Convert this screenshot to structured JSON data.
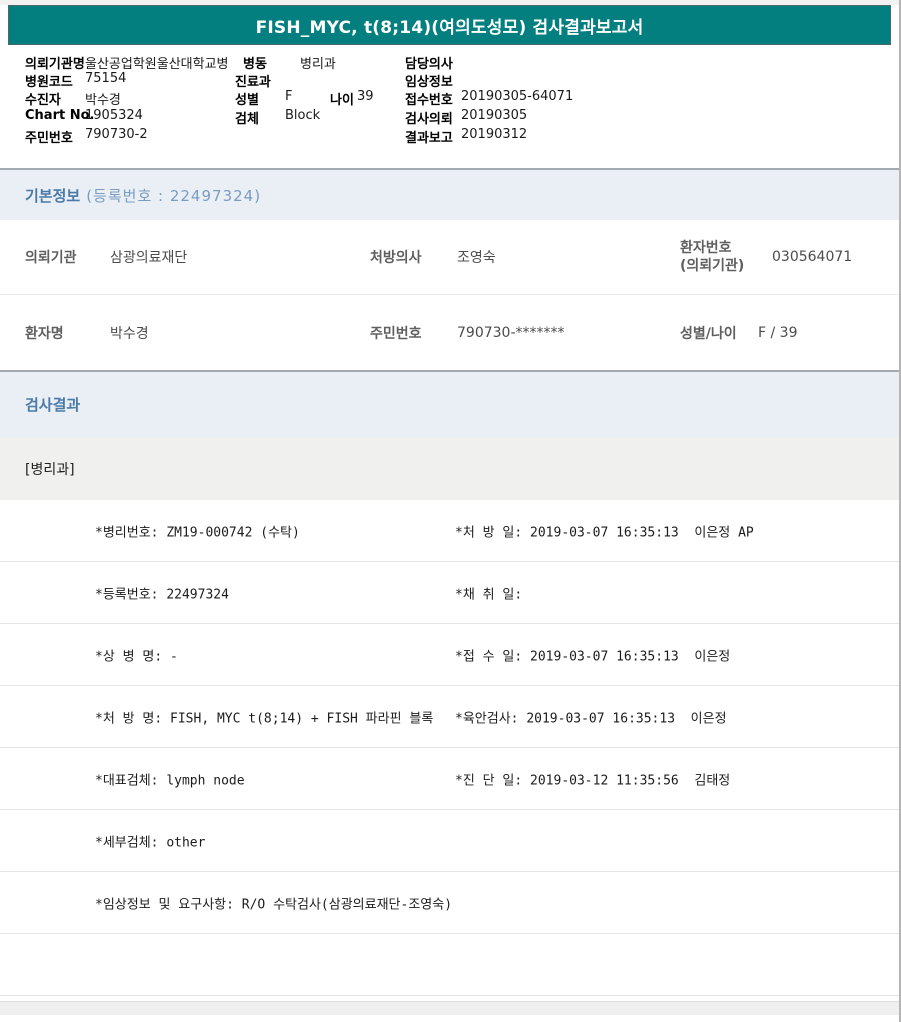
{
  "title_bar": {
    "text": "FISH_MYC, t(8;14)(여의도성모) 검사결과보고서",
    "bg_color": "#047f7f",
    "text_color": "#ffffff"
  },
  "patient_header": {
    "row1": {
      "l1": "의뢰기관명",
      "v1": "울산공업학원울산대학교병",
      "l2": "병동",
      "v2": "병리과",
      "l3": "담당의사",
      "v3": ""
    },
    "row2": {
      "l1": "병원코드",
      "v1": "75154",
      "l2": "진료과",
      "v2": "",
      "l3": "임상정보",
      "v3": ""
    },
    "row3": {
      "l1": "수진자",
      "v1": "박수경",
      "l2": "성별",
      "v2": "F",
      "l2b": "나이",
      "v2b": "39",
      "l3": "접수번호",
      "v3": "20190305-64071"
    },
    "row4": {
      "l1": "Chart No.",
      "v1": "1905324",
      "l2": "검체",
      "v2": "Block",
      "l3": "검사의뢰",
      "v3": "20190305"
    },
    "row5": {
      "l1": "주민번호",
      "v1": "790730-2",
      "l3": "결과보고",
      "v3": "20190312"
    }
  },
  "basic_info": {
    "section_title": "기본정보",
    "section_subtitle": "(등록번호 : 22497324)",
    "referral_org_label": "의뢰기관",
    "referral_org_value": "삼광의료재단",
    "prescribing_doctor_label": "처방의사",
    "prescribing_doctor_value": "조영숙",
    "patient_no_label_line1": "환자번호",
    "patient_no_label_line2": "(의뢰기관)",
    "patient_no_value": "030564071",
    "patient_name_label": "환자명",
    "patient_name_value": "박수경",
    "resident_no_label": "주민번호",
    "resident_no_value": "790730-*******",
    "sex_age_label": "성별/나이",
    "sex_age_value": "F / 39"
  },
  "results": {
    "section_title": "검사결과",
    "department": "[병리과]",
    "rows": [
      {
        "left": "*병리번호: ZM19-000742 (수탁)",
        "right": "*처 방 일: 2019-03-07 16:35:13  이은정 AP"
      },
      {
        "left": "*등록번호: 22497324",
        "right": "*채 취 일:"
      },
      {
        "left": "*상 병 명: -",
        "right": "*접 수 일: 2019-03-07 16:35:13  이은정"
      },
      {
        "left": "*처 방 명: FISH, MYC t(8;14) + FISH 파라핀 블록",
        "right": "*육안검사: 2019-03-07 16:35:13  이은정"
      },
      {
        "left": "*대표검체: lymph node",
        "right": "*진 단 일: 2019-03-12 11:35:56  김태정"
      },
      {
        "left": "*세부검체: other",
        "right": ""
      },
      {
        "left": "*임상정보 및 요구사항: R/O 수탁검사(삼광의료재단-조영숙)",
        "right": ""
      },
      {
        "left": "",
        "right": ""
      }
    ]
  },
  "colors": {
    "title_teal": "#047f7f",
    "section_bg": "#eaeff6",
    "section_title_blue": "#4a7aa6",
    "section_subtitle_blue": "#7a9cc0",
    "dept_row_bg": "#f0f0ef",
    "row_divider": "#e4e4e4"
  }
}
